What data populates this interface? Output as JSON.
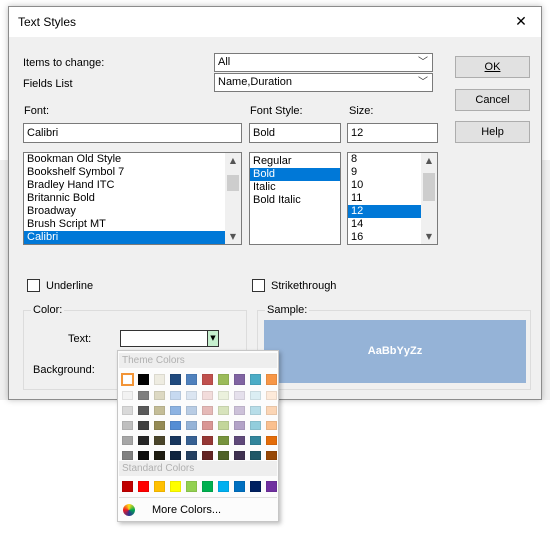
{
  "window": {
    "title": "Text Styles",
    "close_glyph": "✕"
  },
  "items_to_change": {
    "label": "Items to change:",
    "value": "All"
  },
  "fields_list": {
    "label": "Fields List",
    "value": "Name,Duration"
  },
  "buttons": {
    "ok": "OK",
    "cancel": "Cancel",
    "help": "Help"
  },
  "font": {
    "label": "Font:",
    "value": "Calibri",
    "list": [
      "Bookman Old Style",
      "Bookshelf Symbol 7",
      "Bradley Hand ITC",
      "Britannic Bold",
      "Broadway",
      "Brush Script MT",
      "Calibri"
    ],
    "selected_index": 6
  },
  "font_style": {
    "label": "Font Style:",
    "value": "Bold",
    "list": [
      "Regular",
      "Bold",
      "Italic",
      "Bold Italic"
    ],
    "selected_index": 1
  },
  "size": {
    "label": "Size:",
    "value": "12",
    "list": [
      "8",
      "9",
      "10",
      "11",
      "12",
      "14",
      "16"
    ],
    "selected_index": 4
  },
  "underline": {
    "label": "Underline",
    "checked": false
  },
  "strikethrough": {
    "label": "Strikethrough",
    "checked": false
  },
  "color_group": {
    "label": "Color:",
    "text_label": "Text:",
    "background_label": "Background:"
  },
  "sample": {
    "label": "Sample:",
    "text": "AaBbYyZz",
    "background": "#95b3d7"
  },
  "palette": {
    "theme_header": "Theme Colors",
    "standard_header": "Standard Colors",
    "more_colors": "More Colors...",
    "theme_colors": [
      "#ffffff",
      "#000000",
      "#eeece1",
      "#1f497d",
      "#4f81bd",
      "#c0504d",
      "#9bbb59",
      "#8064a2",
      "#4bacc6",
      "#f79646"
    ],
    "theme_shades": [
      [
        "#f2f2f2",
        "#d9d9d9",
        "#bfbfbf",
        "#a6a6a6",
        "#808080"
      ],
      [
        "#7f7f7f",
        "#595959",
        "#404040",
        "#262626",
        "#0d0d0d"
      ],
      [
        "#ddd9c3",
        "#c4bd97",
        "#948a54",
        "#4a452a",
        "#1e1c11"
      ],
      [
        "#c6d9f0",
        "#8db3e2",
        "#548dd4",
        "#17365d",
        "#0f243e"
      ],
      [
        "#dbe5f1",
        "#b8cce4",
        "#95b3d7",
        "#366092",
        "#244061"
      ],
      [
        "#f2dcdb",
        "#e5b9b7",
        "#d99694",
        "#953734",
        "#632423"
      ],
      [
        "#ebf1dd",
        "#d7e3bc",
        "#c3d69b",
        "#76923c",
        "#4f6128"
      ],
      [
        "#e5e0ec",
        "#ccc1d9",
        "#b2a2c7",
        "#5f497a",
        "#3f3151"
      ],
      [
        "#dbeef3",
        "#b7dde8",
        "#92cddc",
        "#31859b",
        "#205867"
      ],
      [
        "#fdeada",
        "#fbd5b5",
        "#fac08f",
        "#e36c09",
        "#974806"
      ]
    ],
    "standard_colors": [
      "#c00000",
      "#ff0000",
      "#ffc000",
      "#ffff00",
      "#92d050",
      "#00b050",
      "#00b0f0",
      "#0070c0",
      "#002060",
      "#7030a0"
    ],
    "selected_color": "#ffffff"
  }
}
